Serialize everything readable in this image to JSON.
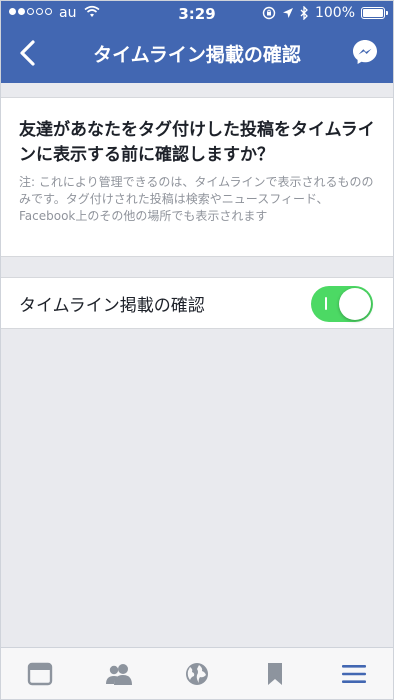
{
  "status_bar": {
    "carrier": "au",
    "time": "3:29",
    "battery": "100%"
  },
  "nav": {
    "title": "タイムライン掲載の確認"
  },
  "review": {
    "heading": "友達があなたをタグ付けした投稿をタイムラインに表示する前に確認しますか？",
    "note": "注: これにより管理できるのは、タイムラインで表示されるもののみです。タグ付けされた投稿は検索やニュースフィード、Facebook上のその他の場所でも表示されます",
    "toggle_label": "タイムライン掲載の確認",
    "toggle_on": true
  },
  "tabbar": {
    "items": [
      "news-feed-icon",
      "friends-icon",
      "globe-icon",
      "bookmark-icon",
      "menu-icon"
    ]
  },
  "colors": {
    "nav_bg": "#4267b2",
    "toggle_on": "#4cd964",
    "active_tab": "#4267b2",
    "inactive_tab": "#8d949e"
  }
}
